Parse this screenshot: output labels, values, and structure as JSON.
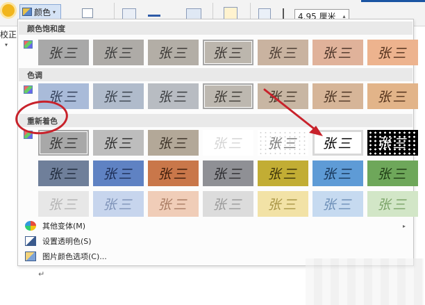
{
  "ribbon": {
    "color_label": "颜色",
    "corrections_label": "校正",
    "height_value": "4.95 厘米",
    "icons": [
      "picture-color-icon",
      "compress-pictures-icon",
      "picture-styles-icon",
      "pen-icon",
      "alt-text-icon",
      "select-icon",
      "crop-icon",
      "height-icon"
    ]
  },
  "panel": {
    "saturation_title": "颜色饱和度",
    "tone_title": "色调",
    "recolor_title": "重新着色",
    "thumbnail_text": "张三",
    "saturation_thumbs": [
      {
        "bg": "#a8a8a8",
        "ink": "#3a3a3a"
      },
      {
        "bg": "#aeaba7",
        "ink": "#3a3a3a"
      },
      {
        "bg": "#b3aea6",
        "ink": "#3b3835"
      },
      {
        "bg": "#bcb6ad",
        "ink": "#3b3632",
        "selected": true
      },
      {
        "bg": "#c9b3a0",
        "ink": "#4a3b32"
      },
      {
        "bg": "#e0b29a",
        "ink": "#4a3226"
      },
      {
        "bg": "#edb38e",
        "ink": "#52301c"
      }
    ],
    "tone_thumbs": [
      {
        "bg": "#a9bbd9",
        "ink": "#33405a"
      },
      {
        "bg": "#b0bbcb",
        "ink": "#39414c"
      },
      {
        "bg": "#b8bcc2",
        "ink": "#3a3d40"
      },
      {
        "bg": "#bdb8b0",
        "ink": "#3c3833",
        "selected": true
      },
      {
        "bg": "#c8b6a3",
        "ink": "#443629"
      },
      {
        "bg": "#d6b598",
        "ink": "#4b3322"
      },
      {
        "bg": "#e2b489",
        "ink": "#52311a"
      }
    ],
    "recolor_thumbs": [
      {
        "bg": "#a8a8a8",
        "ink": "#333333",
        "selected": true
      },
      {
        "bg": "#bdbdbd",
        "ink": "#2e2e2e"
      },
      {
        "bg": "#b3a898",
        "ink": "#3b3126"
      },
      {
        "bg": "#ffffff",
        "ink": "#d4d4d4"
      },
      {
        "bg": "#ffffff",
        "ink": "#7a7a7a",
        "speckled": true
      },
      {
        "bg": "#ffffff",
        "ink": "#000000",
        "highlighted": true
      },
      {
        "bg": "#000000",
        "ink": "#ffffff",
        "speckled": true
      },
      {
        "bg": "#6f7f9a",
        "ink": "#1f2a3b"
      },
      {
        "bg": "#5f82c3",
        "ink": "#1c2d55"
      },
      {
        "bg": "#c9774a",
        "ink": "#3d1c0b"
      },
      {
        "bg": "#8f9095",
        "ink": "#2c2c2f"
      },
      {
        "bg": "#c2ad34",
        "ink": "#3c330a"
      },
      {
        "bg": "#5e9bd6",
        "ink": "#173558"
      },
      {
        "bg": "#6ea75a",
        "ink": "#1e3a14"
      },
      {
        "bg": "#e7e7e7",
        "ink": "#b4b4b4"
      },
      {
        "bg": "#c7d5ed",
        "ink": "#7f93b8"
      },
      {
        "bg": "#f0cdb8",
        "ink": "#a97c63"
      },
      {
        "bg": "#dcdcdc",
        "ink": "#9a9a9a"
      },
      {
        "bg": "#f2e2a6",
        "ink": "#a99646"
      },
      {
        "bg": "#c6daf0",
        "ink": "#6d8fb7"
      },
      {
        "bg": "#d2e6c7",
        "ink": "#7ba468"
      }
    ],
    "menu": [
      {
        "label": "其他变体(M)",
        "icon": "palette-icon",
        "submenu": true
      },
      {
        "label": "设置透明色(S)",
        "icon": "set-transparent-icon",
        "submenu": false
      },
      {
        "label": "图片颜色选项(C)...",
        "icon": "picture-color-options-icon",
        "submenu": false
      }
    ]
  },
  "document": {
    "paragraph_mark": "↵"
  },
  "colors": {
    "annotation": "#c8222b",
    "selection_border": "#a6a6a6",
    "ribbon_bg": "#f3f3f3",
    "section_header_bg": "#e9e9e9"
  }
}
